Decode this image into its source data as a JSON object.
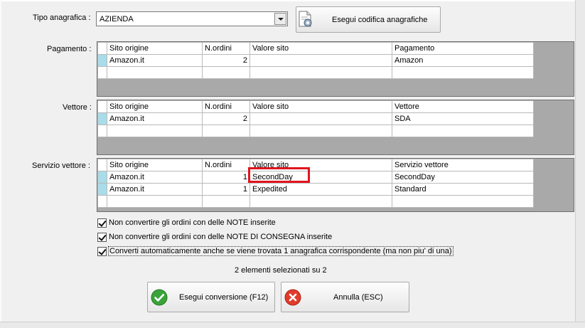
{
  "tipo": {
    "label": "Tipo anagrafica :",
    "value": "AZIENDA",
    "codifica_button": "Esegui codifica anagrafiche"
  },
  "pagamento": {
    "label": "Pagamento :",
    "headers": [
      "Sito origine",
      "N.ordini",
      "Valore sito",
      "Pagamento"
    ],
    "rows": [
      [
        "Amazon.it",
        "2",
        "",
        "Amazon"
      ]
    ]
  },
  "vettore": {
    "label": "Vettore :",
    "headers": [
      "Sito origine",
      "N.ordini",
      "Valore sito",
      "Vettore"
    ],
    "rows": [
      [
        "Amazon.it",
        "2",
        "",
        "SDA"
      ]
    ]
  },
  "servizio": {
    "label": "Servizio vettore :",
    "headers": [
      "Sito origine",
      "N.ordini",
      "Valore sito",
      "Servizio vettore"
    ],
    "rows": [
      [
        "Amazon.it",
        "1",
        "SecondDay",
        "SecondDay"
      ],
      [
        "Amazon.it",
        "1",
        "Expedited",
        "Standard"
      ]
    ]
  },
  "options": [
    {
      "label": "Non convertire gli ordini con delle NOTE inserite",
      "checked": true
    },
    {
      "label": "Non convertire gli ordini con delle NOTE DI CONSEGNA inserite",
      "checked": true
    },
    {
      "label": "Converti automaticamente anche se viene trovata 1 anagrafica corrispondente (ma non piu' di una)",
      "checked": true
    }
  ],
  "status": "2 elementi selezionati su 2",
  "buttons": {
    "convert": "Esegui conversione (F12)",
    "cancel": "Annulla (ESC)"
  },
  "colors": {
    "ok_icon": "#3aa33a",
    "cancel_icon": "#e03b2b",
    "highlight": "#e1141e",
    "row_selector": "#a9dbe8"
  },
  "icons": {
    "codifica": "document-gear-icon",
    "convert": "check-circle-icon",
    "cancel": "x-circle-icon"
  }
}
